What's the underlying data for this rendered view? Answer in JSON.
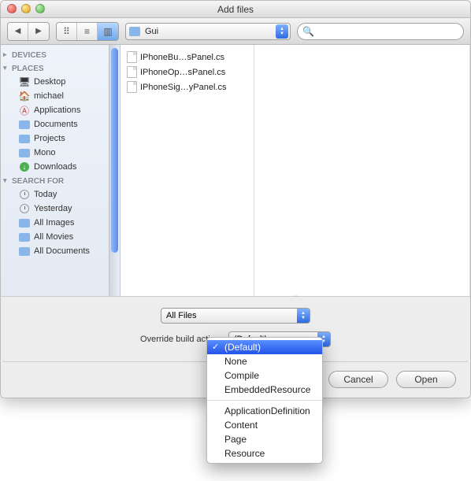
{
  "window": {
    "title": "Add files"
  },
  "toolbar": {
    "path_folder": "Gui",
    "search_placeholder": ""
  },
  "sidebar": {
    "sections": {
      "devices": "DEVICES",
      "places": "PLACES",
      "search": "SEARCH FOR"
    },
    "places": [
      {
        "label": "Desktop",
        "icon": "desktop"
      },
      {
        "label": "michael",
        "icon": "home"
      },
      {
        "label": "Applications",
        "icon": "apps"
      },
      {
        "label": "Documents",
        "icon": "folder"
      },
      {
        "label": "Projects",
        "icon": "folder"
      },
      {
        "label": "Mono",
        "icon": "folder"
      },
      {
        "label": "Downloads",
        "icon": "downloads"
      }
    ],
    "search_items": [
      {
        "label": "Today",
        "icon": "clock"
      },
      {
        "label": "Yesterday",
        "icon": "clock"
      },
      {
        "label": "All Images",
        "icon": "folder"
      },
      {
        "label": "All Movies",
        "icon": "folder"
      },
      {
        "label": "All Documents",
        "icon": "folder"
      }
    ]
  },
  "files": [
    "IPhoneBu…sPanel.cs",
    "IPhoneOp…sPanel.cs",
    "IPhoneSig…yPanel.cs"
  ],
  "filter": {
    "label": "All Files",
    "override_label": "Override build action:",
    "override_value": "(Default)"
  },
  "dropdown": {
    "items_a": [
      "(Default)",
      "None",
      "Compile",
      "EmbeddedResource"
    ],
    "items_b": [
      "ApplicationDefinition",
      "Content",
      "Page",
      "Resource"
    ],
    "selected": "(Default)"
  },
  "buttons": {
    "cancel": "Cancel",
    "open": "Open"
  }
}
